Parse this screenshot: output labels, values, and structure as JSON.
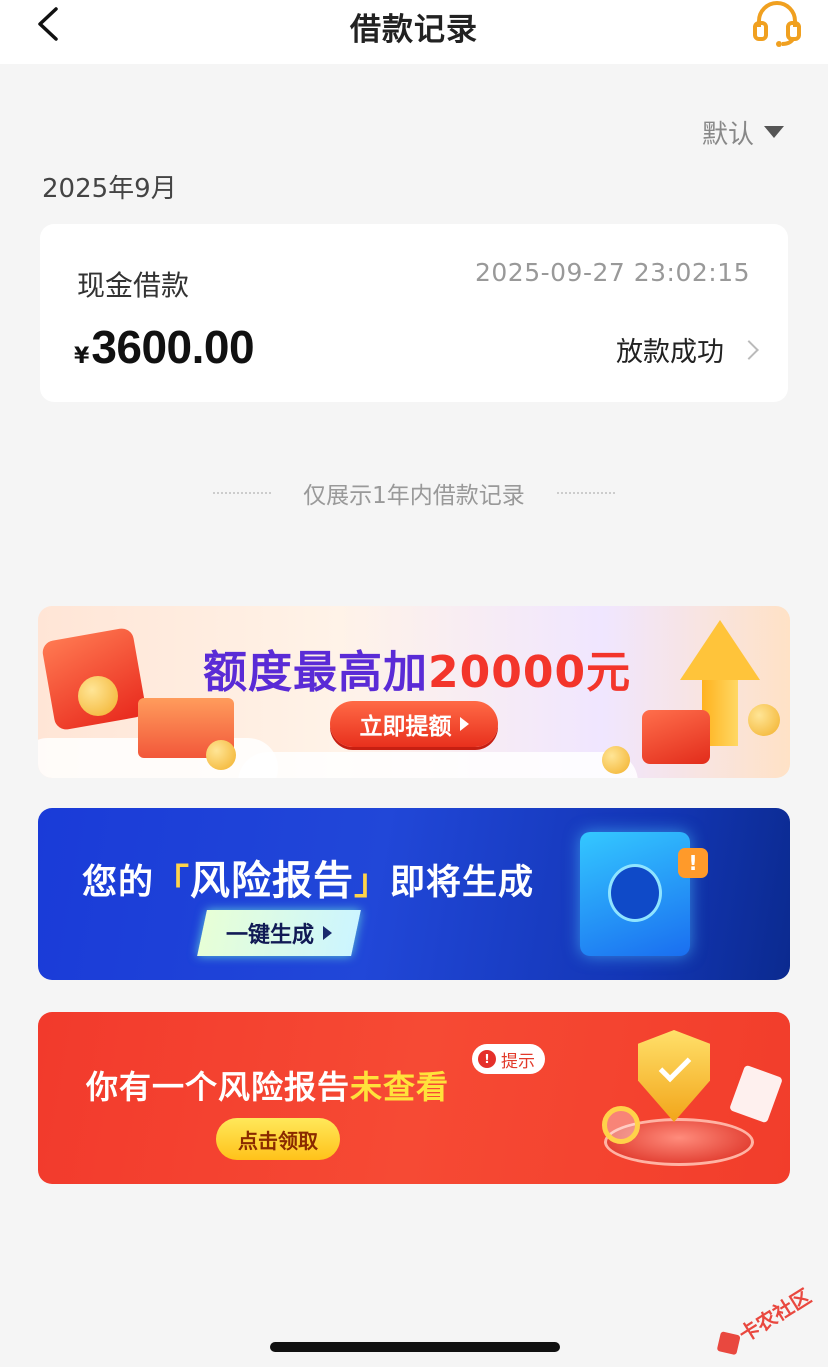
{
  "header": {
    "title": "借款记录"
  },
  "filter": {
    "sort_label": "默认"
  },
  "records": {
    "month": "2025年9月",
    "items": [
      {
        "type": "现金借款",
        "time": "2025-09-27 23:02:15",
        "currency": "¥",
        "amount": "3600.00",
        "status": "放款成功"
      }
    ]
  },
  "notice": "仅展示1年内借款记录",
  "banners": {
    "credit": {
      "title_prefix": "额度最高加",
      "title_highlight": "20000元",
      "button_label": "立即提额"
    },
    "risk_report": {
      "title_prefix": "您的",
      "title_highlight": "风险报告",
      "title_suffix": "即将生成",
      "button_label": "一键生成",
      "badge": "!"
    },
    "unviewed_report": {
      "title_prefix": "你有一个风险报告",
      "title_highlight": "未查看",
      "tip_label": "提示",
      "tip_icon": "!",
      "button_label": "点击领取"
    }
  },
  "watermark": {
    "text": "卡农社区"
  },
  "colors": {
    "accent_orange": "#f0a020",
    "status_red": "#e8362c",
    "purple_title": "#5a2bd6",
    "banner_blue": "#1a3bd8",
    "banner_red": "#f23a2c"
  },
  "icons": {
    "back": "chevron-left-icon",
    "support": "headset-icon",
    "sort": "caret-down-icon",
    "record_arrow": "chevron-right-icon"
  }
}
